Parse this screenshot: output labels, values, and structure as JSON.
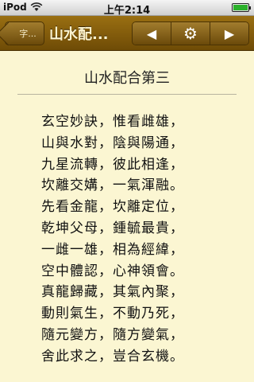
{
  "status": {
    "carrier": "iPod",
    "time": "上午2:14",
    "wifi_icon": "wifi-icon",
    "battery_level": 1.0
  },
  "nav": {
    "back_label": "字...",
    "title": "山水配...",
    "prev_icon": "◀",
    "settings_icon": "⚙",
    "next_icon": "▶"
  },
  "page": {
    "chapter_title": "山水配合第三",
    "verses": [
      "玄空妙訣，惟看雌雄，",
      "山與水對，陰與陽通，",
      "九星流轉，彼此相逢，",
      "坎離交媾，一氣渾融。",
      "先看金龍，坎離定位，",
      "乾坤父母，鍾毓最貴，",
      "一雌一雄，相為經緯，",
      "空中體認，心神領會。",
      "真龍歸藏，其氣內聚，",
      "動則氣生，不動乃死，",
      "隨元變方，隨方變氣，",
      "舍此求之，豈合玄機。"
    ]
  }
}
